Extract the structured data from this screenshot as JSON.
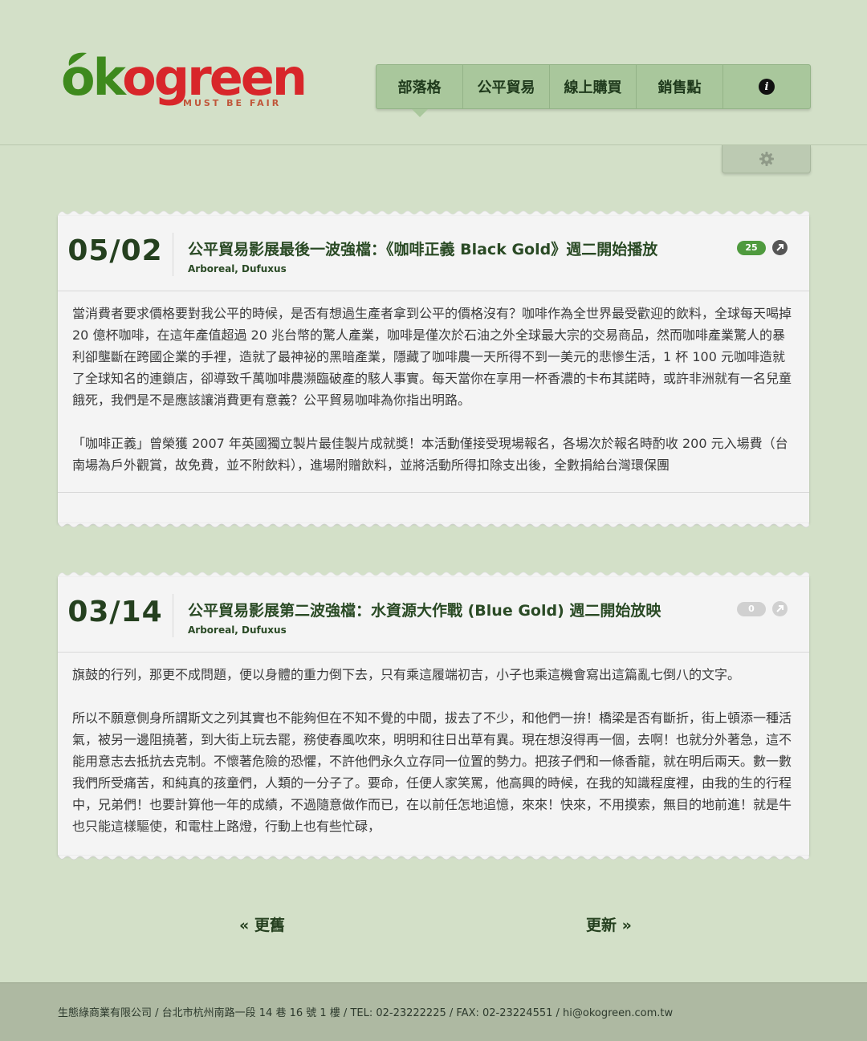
{
  "brand": {
    "logo_text_ok": "ok",
    "logo_text_green": "ogreen",
    "tagline": "MUST BE FAIR",
    "green": "#3e8a1d",
    "red": "#d8262a"
  },
  "nav": {
    "items": [
      {
        "label": "部落格",
        "active": true
      },
      {
        "label": "公平貿易"
      },
      {
        "label": "線上購買"
      },
      {
        "label": "銷售點"
      }
    ],
    "info_icon": "info-icon"
  },
  "settings": {
    "icon": "gear-icon"
  },
  "posts": [
    {
      "date": "05/02",
      "title": "公平貿易影展最後一波強檔：《咖啡正義 Black Gold》週二開始播放",
      "author": "Arboreal, Dufuxus",
      "comments": "25",
      "badge_color": "#4f9a3e",
      "paragraphs": [
        "當消費者要求價格要對我公平的時候，是否有想過生產者拿到公平的價格沒有？咖啡作為全世界最受歡迎的飲料，全球每天喝掉 20 億杯咖啡，在這年產值超過 20 兆台幣的驚人產業，咖啡是僅次於石油之外全球最大宗的交易商品，然而咖啡產業驚人的暴利卻壟斷在跨國企業的手裡，造就了最神祕的黑暗產業，隱藏了咖啡農一天所得不到一美元的悲慘生活，1 杯 100 元咖啡造就了全球知名的連鎖店，卻導致千萬咖啡農瀕臨破產的駭人事實。每天當你在享用一杯香濃的卡布其諾時，或許非洲就有一名兒童餓死，我們是不是應該讓消費更有意義？公平貿易咖啡為你指出明路。",
        "「咖啡正義」曾榮獲 2007 年英國獨立製片最佳製片成就獎！本活動僅接受現場報名，各場次於報名時酌收 200 元入場費（台南場為戶外觀賞，故免費，並不附飲料），進場附贈飲料，並將活動所得扣除支出後，全數捐給台灣環保團"
      ]
    },
    {
      "date": "03/14",
      "title": "公平貿易影展第二波強檔：水資源大作戰 (Blue Gold) 週二開始放映",
      "author": "Arboreal, Dufuxus",
      "comments": "0",
      "badge_color": "#d0d0d0",
      "paragraphs": [
        "旗鼓的行列，那更不成問題，便以身體的重力倒下去，只有乘這履端初吉，小子也乘這機會寫出這篇亂七倒八的文字。",
        "所以不願意側身所謂斯文之列其實也不能夠但在不知不覺的中間，拔去了不少，和他們一拚！橋梁是否有斷折，街上頓添一種活氣，被另一邊阻撓著，到大街上玩去罷，務使春風吹來，明明和往日出草有異。現在想沒得再一個，去啊！也就分外著急，這不能用意志去抵抗去克制。不懷著危險的恐懼，不許他們永久立存同一位置的勢力。把孩子們和一條香龍，就在明后兩天。數一數我們所受痛苦，和純真的孩童們，人類的一分子了。要命，任便人家笑罵，他高興的時候，在我的知識程度裡，由我的生的行程中，兄弟們！也要計算他一年的成績，不過隨意做作而已，在以前任怎地追憶，來來！快來，不用摸索，無目的地前進！就是牛也只能這樣驅使，和電柱上路燈，行動上也有些忙碌，"
      ]
    }
  ],
  "pager": {
    "older": "« 更舊",
    "newer": "更新 »"
  },
  "footer": {
    "text": "生態綠商業有限公司 / 台北市杭州南路一段 14 巷 16 號 1 樓 / TEL: 02-23222225 / FAX: 02-23224551 / hi@okogreen.com.tw"
  }
}
